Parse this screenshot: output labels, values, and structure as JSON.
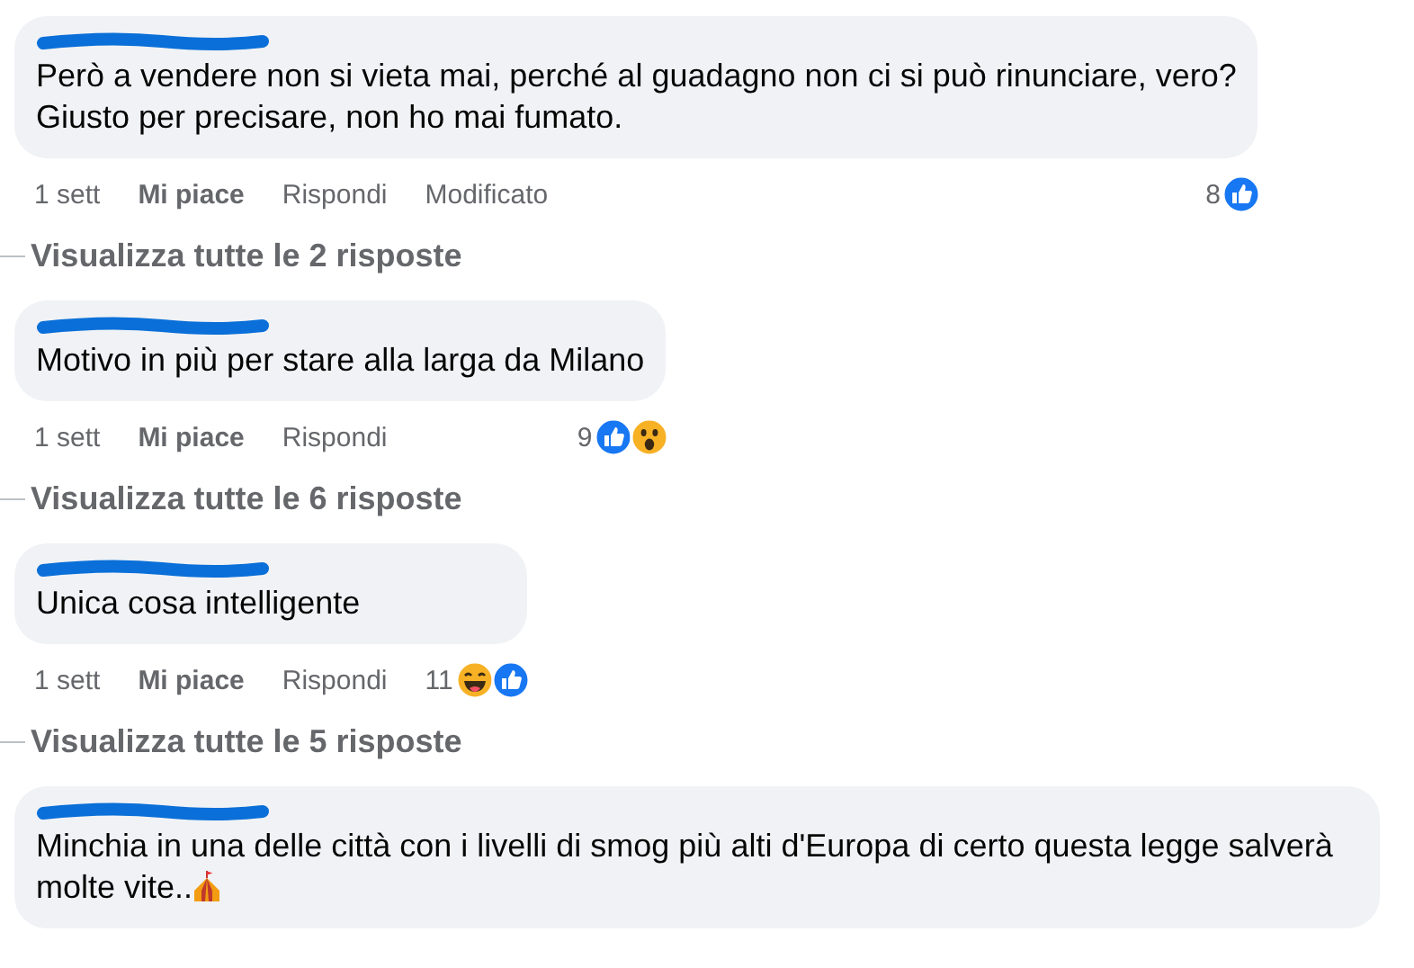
{
  "comments": [
    {
      "text": "Però a vendere non si vieta mai, perché al guadagno non ci si può rinunciare, vero?\nGiusto per precisare, non ho mai fumato.",
      "time": "1 sett",
      "like": "Mi piace",
      "reply": "Rispondi",
      "edited": "Modificato",
      "reaction_count": "8",
      "reactions": [
        {
          "kind": "like"
        }
      ],
      "view_replies": "Visualizza tutte le 2 risposte"
    },
    {
      "text": "Motivo in più per stare alla larga da Milano",
      "time": "1 sett",
      "like": "Mi piace",
      "reply": "Rispondi",
      "reaction_count": "9",
      "reactions": [
        {
          "kind": "like"
        },
        {
          "kind": "wow"
        }
      ],
      "view_replies": "Visualizza tutte le 6 risposte"
    },
    {
      "text": "Unica cosa intelligente",
      "time": "1 sett",
      "like": "Mi piace",
      "reply": "Rispondi",
      "reaction_count": "11",
      "reactions": [
        {
          "kind": "haha"
        },
        {
          "kind": "like"
        }
      ],
      "view_replies": "Visualizza tutte le 5 risposte"
    },
    {
      "text": "Minchia in una delle città con i livelli di smog più alti d'Europa di certo questa legge salverà molte vite..",
      "emoji": {
        "kind": "circus-tent"
      }
    }
  ]
}
